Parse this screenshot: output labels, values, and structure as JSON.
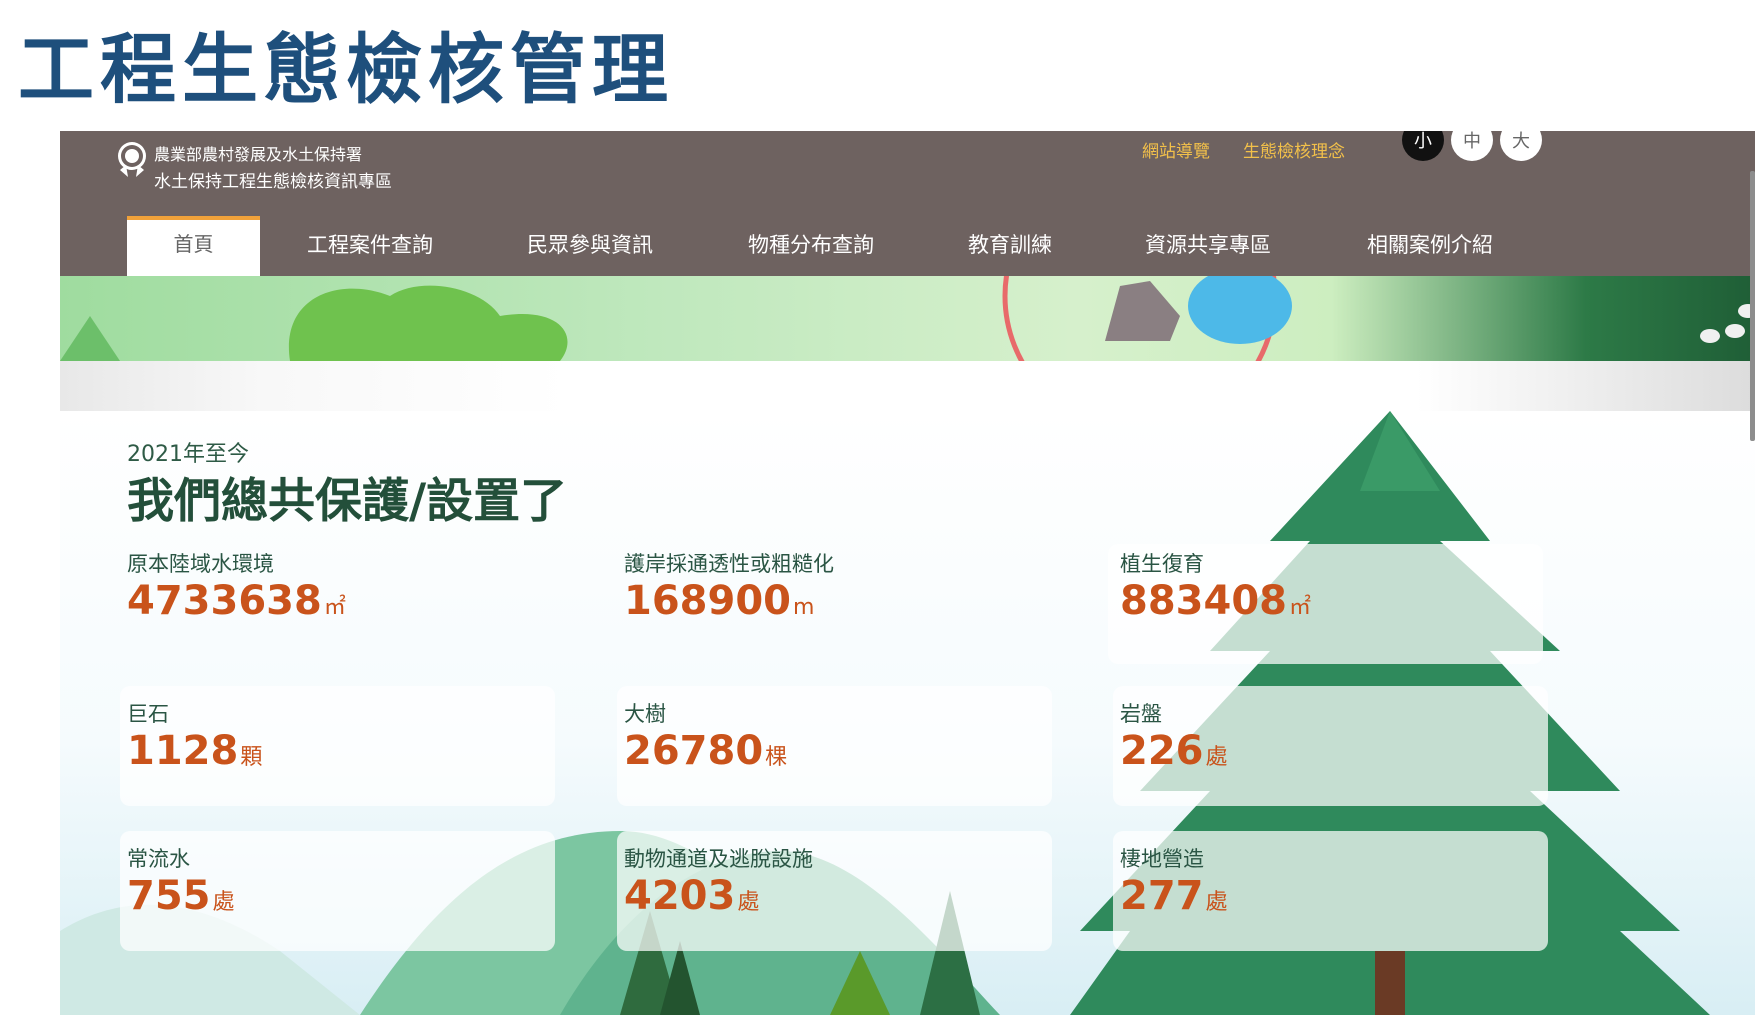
{
  "slide": {
    "title": "工程生態檢核管理"
  },
  "site": {
    "org_line1": "農業部農村發展及水土保持署",
    "org_line2": "水土保持工程生態檢核資訊專區",
    "top_links": [
      "網站導覽",
      "生態檢核理念"
    ],
    "font_sizes": [
      "小",
      "中",
      "大"
    ]
  },
  "nav": {
    "items": [
      "首頁",
      "工程案件查詢",
      "民眾參與資訊",
      "物種分布查詢",
      "教育訓練",
      "資源共享專區",
      "相關案例介紹"
    ]
  },
  "stats": {
    "since": "2021年至今",
    "headline": "我們總共保護/設置了",
    "cards": [
      {
        "label": "原本陸域水環境",
        "value": "4733638",
        "unit": "㎡"
      },
      {
        "label": "護岸採通透性或粗糙化",
        "value": "168900",
        "unit": "m"
      },
      {
        "label": "植生復育",
        "value": "883408",
        "unit": "㎡"
      },
      {
        "label": "巨石",
        "value": "1128",
        "unit": "顆"
      },
      {
        "label": "大樹",
        "value": "26780",
        "unit": "棵"
      },
      {
        "label": "岩盤",
        "value": "226",
        "unit": "處"
      },
      {
        "label": "常流水",
        "value": "755",
        "unit": "處"
      },
      {
        "label": "動物通道及逃脫設施",
        "value": "4203",
        "unit": "處"
      },
      {
        "label": "棲地營造",
        "value": "277",
        "unit": "處"
      }
    ]
  },
  "colors": {
    "title_blue": "#1e4f7c",
    "topbar": "#6e6260",
    "link_gold": "#f2c04a",
    "nav_active_border": "#f0a13a",
    "value_orange": "#c9531b",
    "headline_green": "#234f3a",
    "tree_green": "#2f8a5c"
  }
}
